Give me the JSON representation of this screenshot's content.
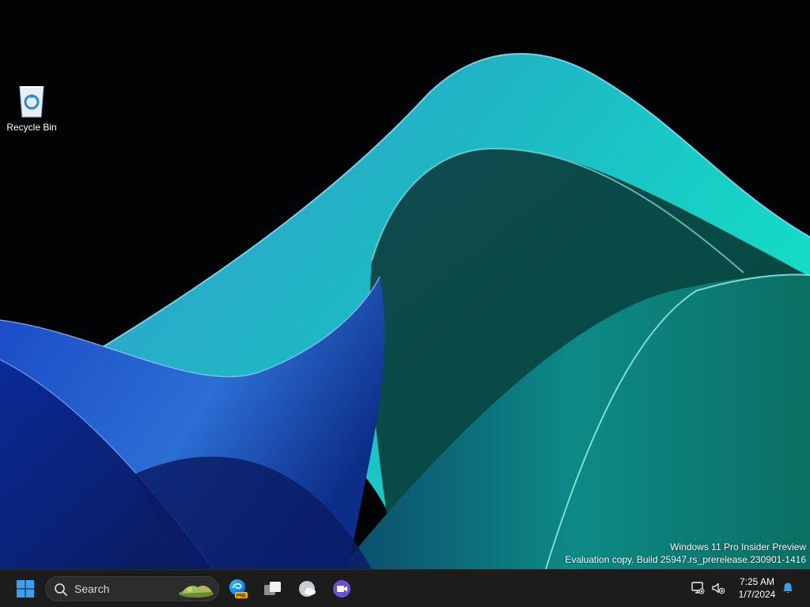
{
  "desktop": {
    "icons": [
      {
        "label": "Recycle Bin",
        "icon": "recycle-bin-icon"
      }
    ],
    "watermark": {
      "line1": "Windows 11 Pro Insider Preview",
      "line2": "Evaluation copy. Build 25947.rs_prerelease.230901-1416"
    }
  },
  "taskbar": {
    "start_icon": "windows-logo-icon",
    "search": {
      "placeholder": "Search",
      "icon": "search-icon"
    },
    "apps": [
      {
        "name": "Microsoft Edge Preview",
        "icon": "edge-pre-icon",
        "badge": "PRE"
      },
      {
        "name": "Task View",
        "icon": "task-view-icon"
      },
      {
        "name": "Weather",
        "icon": "weather-icon"
      },
      {
        "name": "Meet",
        "icon": "meet-video-icon"
      }
    ],
    "tray": {
      "network_icon": "network-disconnected-icon",
      "volume_icon": "volume-muted-icon",
      "time": "7:25 AM",
      "date": "1/7/2024",
      "notification_icon": "bell-icon"
    }
  },
  "colors": {
    "taskbar_bg": "#1c1c1c",
    "windows_blue": "#3aa0f0",
    "teams_purple": "#6b4fd8",
    "wallpaper_teal": "#1fd6b8",
    "wallpaper_blue": "#1c4ec8"
  }
}
